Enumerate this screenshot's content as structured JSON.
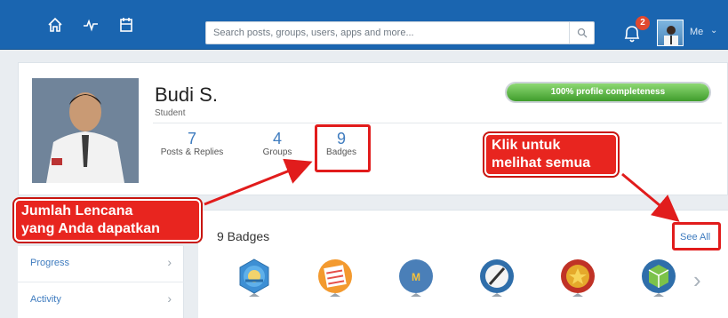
{
  "nav": {
    "icons": [
      "home-icon",
      "activity-icon",
      "calendar-icon"
    ],
    "search_placeholder": "Search posts, groups, users, apps and more...",
    "notification_count": "2",
    "me_label": "Me"
  },
  "profile": {
    "name": "Budi S.",
    "role": "Student",
    "completeness_text": "100% profile completeness",
    "completeness_value": 100,
    "stats": [
      {
        "num": "7",
        "label": "Posts & Replies"
      },
      {
        "num": "4",
        "label": "Groups"
      },
      {
        "num": "9",
        "label": "Badges"
      }
    ]
  },
  "sidebar": {
    "items": [
      {
        "label": "Progress"
      },
      {
        "label": "Activity"
      }
    ]
  },
  "badges": {
    "title": "9 Badges",
    "see_all": "See All",
    "icons": [
      "globe-badge-icon",
      "calendar-badge-icon",
      "math-badge-icon",
      "pen-badge-icon",
      "star-medal-badge-icon",
      "pencil-cube-badge-icon"
    ]
  },
  "annotations": {
    "callout_left_line1": "Jumlah Lencana",
    "callout_left_line2": "yang Anda dapatkan",
    "callout_right_line1": "Klik untuk",
    "callout_right_line2": "melihat semua"
  },
  "colors": {
    "topbar": "#1a65b0",
    "accent": "#3f7cbf",
    "annotation_red": "#e8251f",
    "progress_green": "#3f9c2c"
  }
}
